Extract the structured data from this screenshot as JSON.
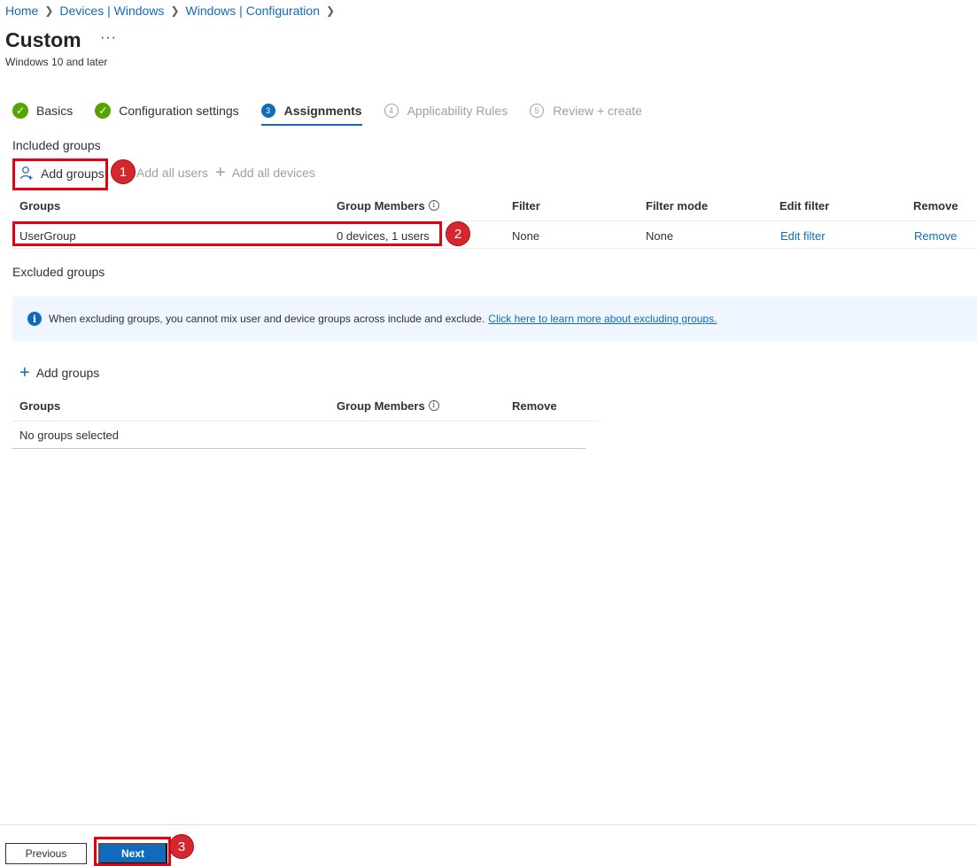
{
  "breadcrumb": [
    "Home",
    "Devices | Windows",
    "Windows | Configuration"
  ],
  "title": "Custom",
  "more_icon": "more-icon",
  "subtitle": "Windows 10 and later",
  "steps": [
    {
      "label": "Basics",
      "num": "",
      "state": "done"
    },
    {
      "label": "Configuration settings",
      "num": "",
      "state": "done"
    },
    {
      "label": "Assignments",
      "num": "3",
      "state": "current"
    },
    {
      "label": "Applicability Rules",
      "num": "4",
      "state": "future"
    },
    {
      "label": "Review + create",
      "num": "5",
      "state": "future"
    }
  ],
  "included": {
    "label": "Included groups",
    "add_groups": "Add groups",
    "add_all_users": "Add all users",
    "add_all_devices": "Add all devices",
    "columns": {
      "groups": "Groups",
      "members": "Group Members",
      "filter": "Filter",
      "filter_mode": "Filter mode",
      "edit_filter": "Edit filter",
      "remove": "Remove"
    },
    "row": {
      "group": "UserGroup",
      "members": "0 devices, 1 users",
      "filter": "None",
      "filter_mode": "None",
      "edit_filter": "Edit filter",
      "remove": "Remove"
    }
  },
  "excluded": {
    "label": "Excluded groups",
    "banner_text": "When excluding groups, you cannot mix user and device groups across include and exclude.",
    "banner_link": "Click here to learn more about excluding groups.",
    "add_groups": "Add groups",
    "columns": {
      "groups": "Groups",
      "members": "Group Members",
      "remove": "Remove"
    },
    "empty": "No groups selected"
  },
  "footer": {
    "previous": "Previous",
    "next": "Next"
  },
  "annotations": [
    "1",
    "2",
    "3"
  ],
  "colors": {
    "accent": "#0f6cbd",
    "success": "#57a300",
    "highlight": "#e60012"
  }
}
